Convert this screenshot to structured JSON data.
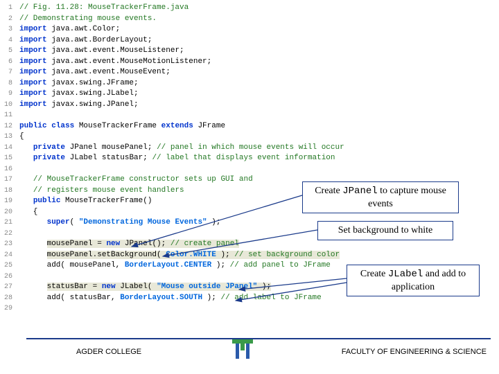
{
  "lines": [
    {
      "n": "1",
      "tokens": [
        {
          "t": "// Fig. 11.28: MouseTrackerFrame.java",
          "c": "cm"
        }
      ]
    },
    {
      "n": "2",
      "tokens": [
        {
          "t": "// Demonstrating mouse events.",
          "c": "cm"
        }
      ]
    },
    {
      "n": "3",
      "tokens": [
        {
          "t": "import",
          "c": "kw"
        },
        {
          "t": " java.awt.Color;",
          "c": "id"
        }
      ]
    },
    {
      "n": "4",
      "tokens": [
        {
          "t": "import",
          "c": "kw"
        },
        {
          "t": " java.awt.BorderLayout;",
          "c": "id"
        }
      ]
    },
    {
      "n": "5",
      "tokens": [
        {
          "t": "import",
          "c": "kw"
        },
        {
          "t": " java.awt.event.MouseListener;",
          "c": "id"
        }
      ]
    },
    {
      "n": "6",
      "tokens": [
        {
          "t": "import",
          "c": "kw"
        },
        {
          "t": " java.awt.event.MouseMotionListener;",
          "c": "id"
        }
      ]
    },
    {
      "n": "7",
      "tokens": [
        {
          "t": "import",
          "c": "kw"
        },
        {
          "t": " java.awt.event.MouseEvent;",
          "c": "id"
        }
      ]
    },
    {
      "n": "8",
      "tokens": [
        {
          "t": "import",
          "c": "kw"
        },
        {
          "t": " javax.swing.JFrame;",
          "c": "id"
        }
      ]
    },
    {
      "n": "9",
      "tokens": [
        {
          "t": "import",
          "c": "kw"
        },
        {
          "t": " javax.swing.JLabel;",
          "c": "id"
        }
      ]
    },
    {
      "n": "10",
      "tokens": [
        {
          "t": "import",
          "c": "kw"
        },
        {
          "t": " javax.swing.JPanel;",
          "c": "id"
        }
      ]
    },
    {
      "n": "11",
      "tokens": []
    },
    {
      "n": "12",
      "tokens": [
        {
          "t": "public class",
          "c": "kw"
        },
        {
          "t": " MouseTrackerFrame ",
          "c": "id"
        },
        {
          "t": "extends",
          "c": "kw"
        },
        {
          "t": " JFrame",
          "c": "id"
        }
      ]
    },
    {
      "n": "13",
      "tokens": [
        {
          "t": "{",
          "c": "id"
        }
      ]
    },
    {
      "n": "14",
      "tokens": [
        {
          "t": "   ",
          "c": "id"
        },
        {
          "t": "private",
          "c": "kw"
        },
        {
          "t": " JPanel mousePanel; ",
          "c": "id"
        },
        {
          "t": "// panel in which mouse events will occur",
          "c": "cm"
        }
      ]
    },
    {
      "n": "15",
      "tokens": [
        {
          "t": "   ",
          "c": "id"
        },
        {
          "t": "private",
          "c": "kw"
        },
        {
          "t": " JLabel statusBar; ",
          "c": "id"
        },
        {
          "t": "// label that displays event information",
          "c": "cm"
        }
      ]
    },
    {
      "n": "16",
      "tokens": []
    },
    {
      "n": "17",
      "tokens": [
        {
          "t": "   ",
          "c": "id"
        },
        {
          "t": "// MouseTrackerFrame constructor sets up GUI and",
          "c": "cm"
        }
      ]
    },
    {
      "n": "18",
      "tokens": [
        {
          "t": "   ",
          "c": "id"
        },
        {
          "t": "// registers mouse event handlers",
          "c": "cm"
        }
      ]
    },
    {
      "n": "19",
      "tokens": [
        {
          "t": "   ",
          "c": "id"
        },
        {
          "t": "public",
          "c": "kw"
        },
        {
          "t": " MouseTrackerFrame()",
          "c": "id"
        }
      ]
    },
    {
      "n": "20",
      "tokens": [
        {
          "t": "   {",
          "c": "id"
        }
      ]
    },
    {
      "n": "21",
      "tokens": [
        {
          "t": "      ",
          "c": "id"
        },
        {
          "t": "super",
          "c": "kw"
        },
        {
          "t": "( ",
          "c": "id"
        },
        {
          "t": "\"Demonstrating Mouse Events\"",
          "c": "st"
        },
        {
          "t": " );",
          "c": "id"
        }
      ]
    },
    {
      "n": "22",
      "tokens": []
    },
    {
      "n": "23",
      "tokens": [
        {
          "t": "      ",
          "c": "id"
        },
        {
          "t": "mousePanel = ",
          "c": "id hi"
        },
        {
          "t": "new",
          "c": "kw hi"
        },
        {
          "t": " JPanel(); ",
          "c": "id hi"
        },
        {
          "t": "// create panel",
          "c": "cm hi"
        }
      ]
    },
    {
      "n": "24",
      "tokens": [
        {
          "t": "      ",
          "c": "id"
        },
        {
          "t": "mousePanel.setBackground( ",
          "c": "id hi"
        },
        {
          "t": "Color.WHITE",
          "c": "cn hi"
        },
        {
          "t": " ); ",
          "c": "id hi"
        },
        {
          "t": "// set background color",
          "c": "cm hi"
        }
      ]
    },
    {
      "n": "25",
      "tokens": [
        {
          "t": "      add( mousePanel, ",
          "c": "id"
        },
        {
          "t": "BorderLayout.CENTER",
          "c": "cn"
        },
        {
          "t": " ); ",
          "c": "id"
        },
        {
          "t": "// add panel to JFrame",
          "c": "cm"
        }
      ]
    },
    {
      "n": "26",
      "tokens": []
    },
    {
      "n": "27",
      "tokens": [
        {
          "t": "      ",
          "c": "id"
        },
        {
          "t": "statusBar = ",
          "c": "id hi"
        },
        {
          "t": "new",
          "c": "kw hi"
        },
        {
          "t": " JLabel( ",
          "c": "id hi"
        },
        {
          "t": "\"Mouse outside JPanel\"",
          "c": "st hi"
        },
        {
          "t": " );",
          "c": "id hi"
        }
      ]
    },
    {
      "n": "28",
      "tokens": [
        {
          "t": "      add( statusBar, ",
          "c": "id"
        },
        {
          "t": "BorderLayout.SOUTH",
          "c": "cn"
        },
        {
          "t": " ); ",
          "c": "id"
        },
        {
          "t": "// add label to JFrame",
          "c": "cm"
        }
      ]
    },
    {
      "n": "29",
      "tokens": []
    }
  ],
  "callouts": {
    "c1": {
      "pre": "Create ",
      "mono": "JPanel",
      "post": " to capture mouse",
      "line2": "events"
    },
    "c2": {
      "text": "Set background to white"
    },
    "c3": {
      "pre": "Create ",
      "mono": "JLabel",
      "post": " and add to",
      "line2": "application"
    }
  },
  "footer": {
    "left": "AGDER COLLEGE",
    "right": "FACULTY OF ENGINEERING & SCIENCE"
  }
}
